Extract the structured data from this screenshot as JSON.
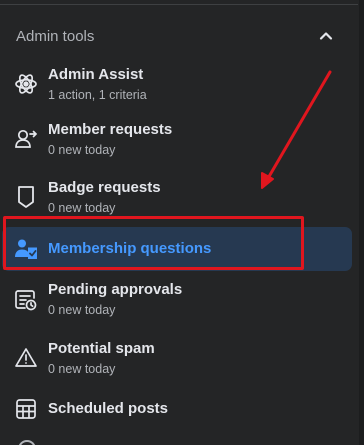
{
  "section": {
    "title": "Admin tools",
    "collapse_icon": "chevron-up-icon"
  },
  "items": [
    {
      "label": "Admin Assist",
      "sub": "1 action, 1 criteria",
      "icon": "admin-assist-icon"
    },
    {
      "label": "Member requests",
      "sub": "0 new today",
      "icon": "member-requests-icon"
    },
    {
      "label": "Badge requests",
      "sub": "0 new today",
      "icon": "badge-icon"
    },
    {
      "label": "Membership questions",
      "sub": "",
      "icon": "membership-questions-icon",
      "active": true
    },
    {
      "label": "Pending approvals",
      "sub": "0 new today",
      "icon": "pending-approvals-icon"
    },
    {
      "label": "Potential spam",
      "sub": "0 new today",
      "icon": "warning-icon"
    },
    {
      "label": "Scheduled posts",
      "sub": "",
      "icon": "calendar-icon"
    }
  ],
  "colors": {
    "background": "#242526",
    "text": "#e4e6eb",
    "secondary_text": "#b0b3b8",
    "active_bg": "#263951",
    "active_text": "#4599ff",
    "annotation": "#e0161e"
  }
}
